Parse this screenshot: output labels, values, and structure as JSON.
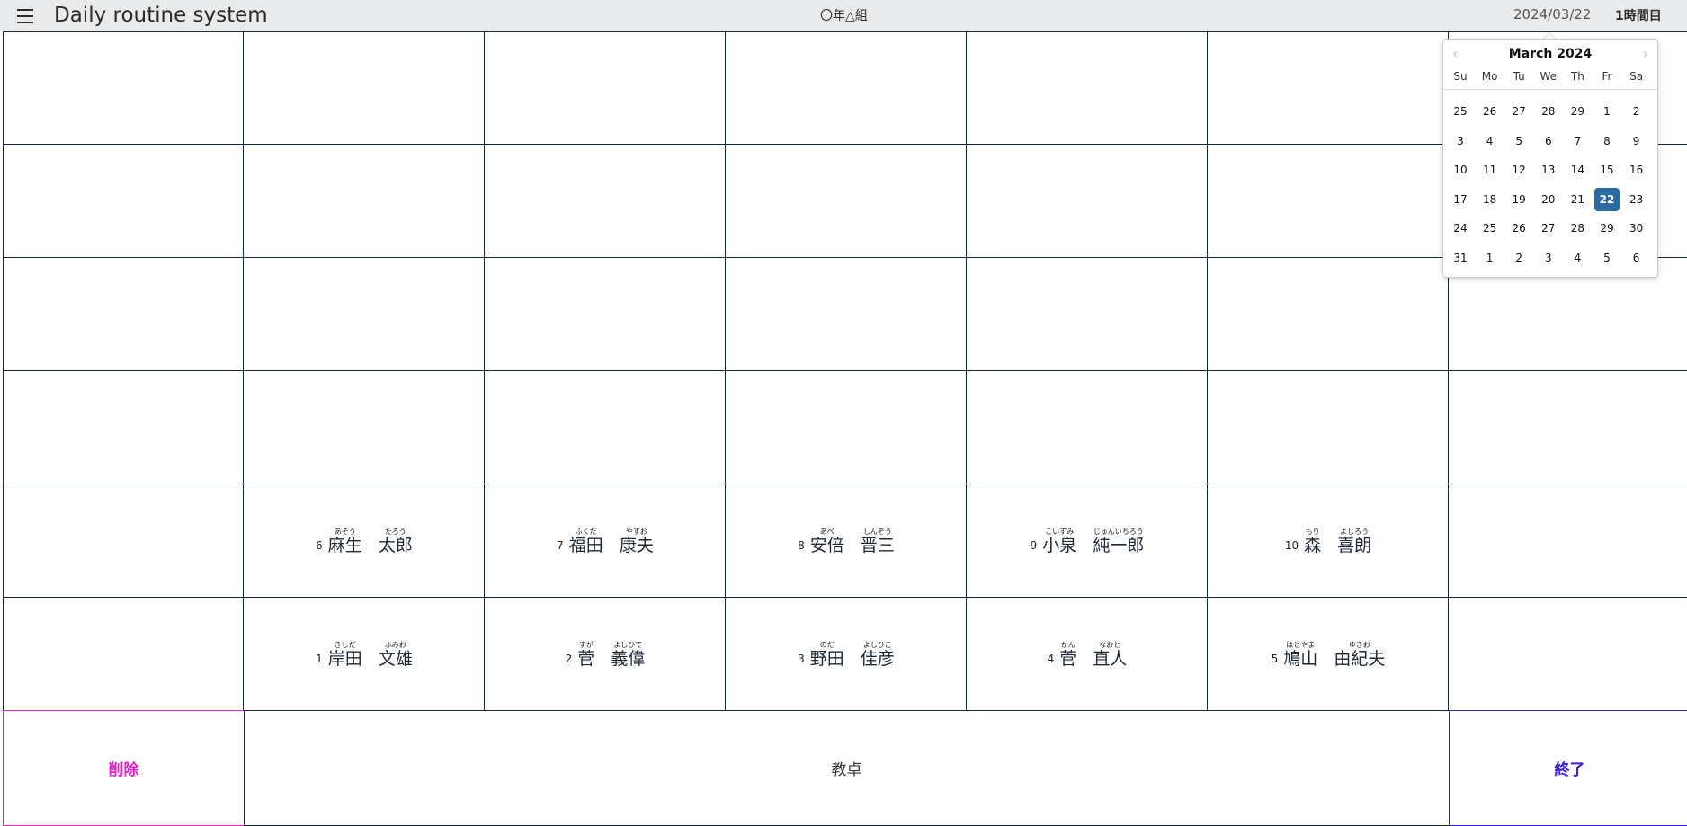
{
  "header": {
    "app_title": "Daily routine system",
    "class_name": "〇年△組",
    "date": "2024/03/22",
    "period": "1時間目",
    "menu_icon": "hamburger-menu-icon"
  },
  "seats": {
    "front_row": [
      {
        "no": "1",
        "family": "岸田",
        "family_kana": "きしだ",
        "given": "文雄",
        "given_kana": "ふみお"
      },
      {
        "no": "2",
        "family": "菅",
        "family_kana": "すが",
        "given": "義偉",
        "given_kana": "よしひで"
      },
      {
        "no": "3",
        "family": "野田",
        "family_kana": "のだ",
        "given": "佳彦",
        "given_kana": "よしひこ"
      },
      {
        "no": "4",
        "family": "菅",
        "family_kana": "かん",
        "given": "直人",
        "given_kana": "なおと"
      },
      {
        "no": "5",
        "family": "鳩山",
        "family_kana": "はとやま",
        "given": "由紀夫",
        "given_kana": "ゆきお"
      }
    ],
    "second_row": [
      {
        "no": "6",
        "family": "麻生",
        "family_kana": "あそう",
        "given": "太郎",
        "given_kana": "たろう"
      },
      {
        "no": "7",
        "family": "福田",
        "family_kana": "ふくだ",
        "given": "康夫",
        "given_kana": "やすお"
      },
      {
        "no": "8",
        "family": "安倍",
        "family_kana": "あべ",
        "given": "晋三",
        "given_kana": "しんぞう"
      },
      {
        "no": "9",
        "family": "小泉",
        "family_kana": "こいずみ",
        "given": "純一郎",
        "given_kana": "じゅんいちろう"
      },
      {
        "no": "10",
        "family": "森",
        "family_kana": "もり",
        "given": "喜朗",
        "given_kana": "よしろう"
      }
    ]
  },
  "bottom": {
    "delete_label": "削除",
    "desk_label": "教卓",
    "end_label": "終了",
    "delete_color": "#e91ed0",
    "end_color": "#3a1ae8"
  },
  "calendar": {
    "month_label": "March 2024",
    "prev_icon": "chevron-left-icon",
    "next_icon": "chevron-right-icon",
    "weekdays": [
      "Su",
      "Mo",
      "Tu",
      "We",
      "Th",
      "Fr",
      "Sa"
    ],
    "weeks": [
      [
        "25",
        "26",
        "27",
        "28",
        "29",
        "1",
        "2"
      ],
      [
        "3",
        "4",
        "5",
        "6",
        "7",
        "8",
        "9"
      ],
      [
        "10",
        "11",
        "12",
        "13",
        "14",
        "15",
        "16"
      ],
      [
        "17",
        "18",
        "19",
        "20",
        "21",
        "22",
        "23"
      ],
      [
        "24",
        "25",
        "26",
        "27",
        "28",
        "29",
        "30"
      ],
      [
        "31",
        "1",
        "2",
        "3",
        "4",
        "5",
        "6"
      ]
    ],
    "selected": "22",
    "selected_color": "#2c6aa3"
  }
}
